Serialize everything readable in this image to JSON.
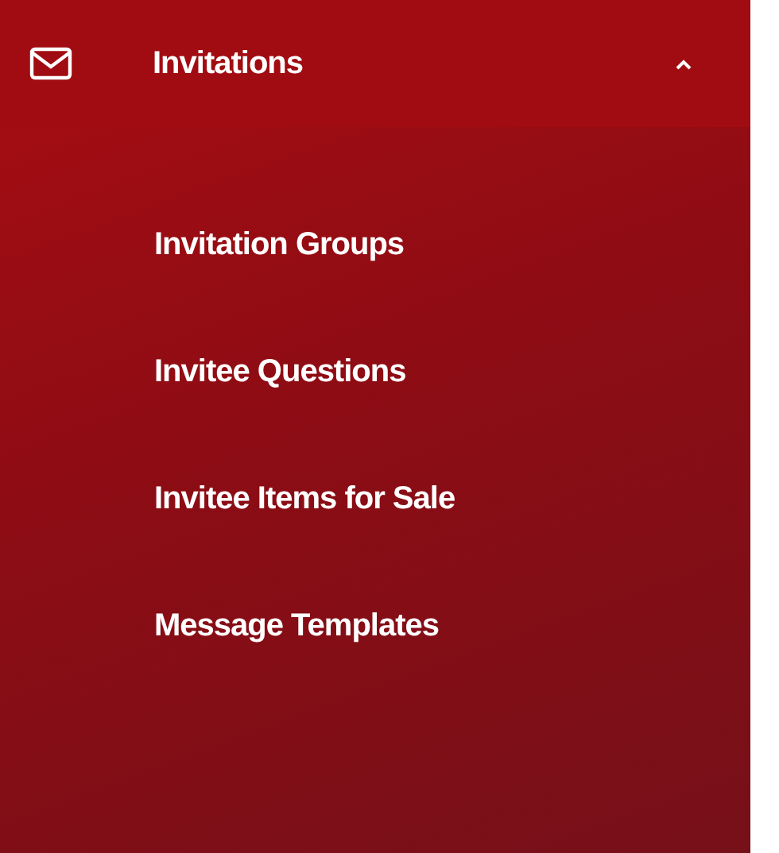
{
  "menu": {
    "label": "Invitations",
    "expanded": true,
    "children": [
      {
        "label": "Invitation Groups"
      },
      {
        "label": "Invitee Questions"
      },
      {
        "label": "Invitee Items for Sale"
      },
      {
        "label": "Message Templates"
      }
    ]
  }
}
